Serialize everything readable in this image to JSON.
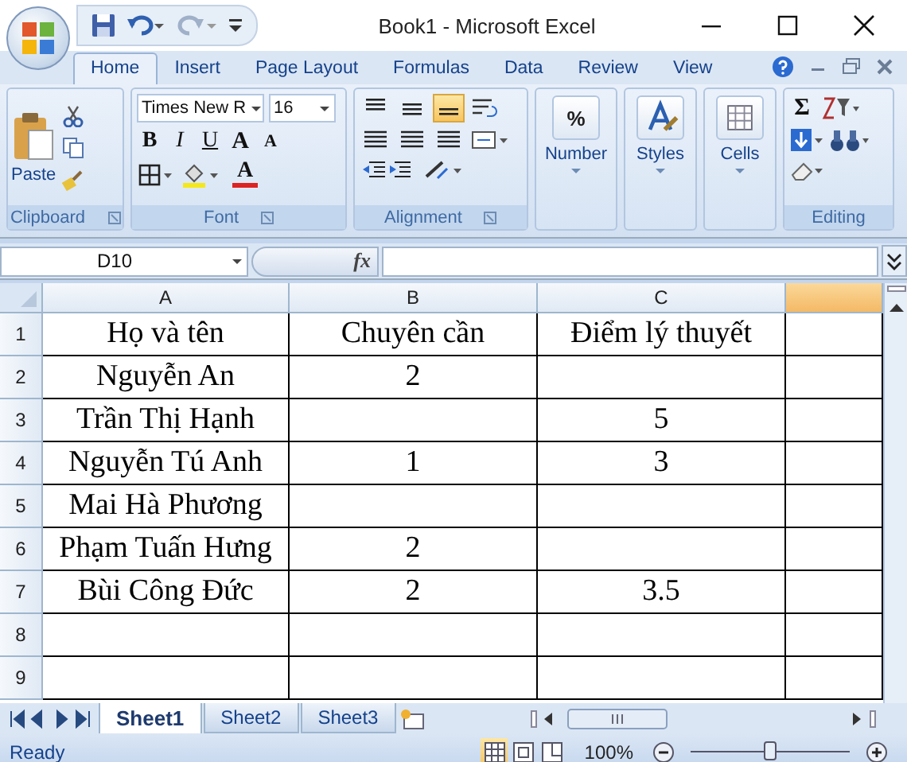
{
  "window": {
    "title": "Book1 - Microsoft Excel"
  },
  "ribbon_tabs": [
    {
      "label": "Home",
      "selected": true
    },
    {
      "label": "Insert",
      "selected": false
    },
    {
      "label": "Page Layout",
      "selected": false
    },
    {
      "label": "Formulas",
      "selected": false
    },
    {
      "label": "Data",
      "selected": false
    },
    {
      "label": "Review",
      "selected": false
    },
    {
      "label": "View",
      "selected": false
    }
  ],
  "ribbon": {
    "clipboard": {
      "label": "Clipboard",
      "paste": "Paste"
    },
    "font": {
      "label": "Font",
      "font_name": "Times New R",
      "font_size": "16",
      "bold": "B",
      "italic": "I",
      "underline": "U",
      "grow": "A",
      "shrink": "A",
      "font_color": "A"
    },
    "alignment": {
      "label": "Alignment",
      "vertical": [
        {
          "selected": false
        },
        {
          "selected": false
        },
        {
          "selected": true
        }
      ]
    },
    "number": {
      "label": "Number",
      "symbol": "%"
    },
    "styles": {
      "label": "Styles"
    },
    "cells": {
      "label": "Cells"
    },
    "editing": {
      "label": "Editing",
      "sum": "Σ"
    }
  },
  "formula_bar": {
    "name_box": "D10",
    "function_symbol": "fx"
  },
  "grid": {
    "columns": [
      {
        "label": "A",
        "selected": false
      },
      {
        "label": "B",
        "selected": false
      },
      {
        "label": "C",
        "selected": false
      },
      {
        "selected": true
      }
    ],
    "rows": [
      {
        "number": "1",
        "cells": [
          "Họ và tên",
          "Chuyên cần",
          "Điểm lý thuyết"
        ]
      },
      {
        "number": "2",
        "cells": [
          "Nguyễn An",
          "2",
          ""
        ]
      },
      {
        "number": "3",
        "cells": [
          "Trần Thị Hạnh",
          "",
          "5"
        ]
      },
      {
        "number": "4",
        "cells": [
          "Nguyễn Tú Anh",
          "1",
          "3"
        ]
      },
      {
        "number": "5",
        "cells": [
          "Mai Hà Phương",
          "",
          ""
        ]
      },
      {
        "number": "6",
        "cells": [
          "Phạm Tuấn Hưng",
          "2",
          ""
        ]
      },
      {
        "number": "7",
        "cells": [
          "Bùi Công Đức",
          "2",
          "3.5"
        ]
      },
      {
        "number": "8",
        "cells": [
          "",
          "",
          ""
        ]
      },
      {
        "number": "9",
        "cells": [
          "",
          "",
          ""
        ]
      }
    ]
  },
  "sheet_tabs": [
    {
      "label": "Sheet1",
      "selected": true
    },
    {
      "label": "Sheet2",
      "selected": false
    },
    {
      "label": "Sheet3",
      "selected": false
    }
  ],
  "status_bar": {
    "status": "Ready",
    "views": [
      {
        "selected": true
      },
      {
        "selected": false
      },
      {
        "selected": false
      }
    ],
    "zoom": "100%",
    "zoom_slider": {
      "level": 0.5
    }
  }
}
